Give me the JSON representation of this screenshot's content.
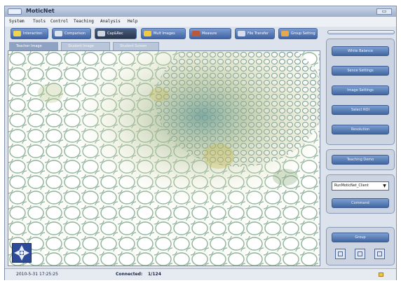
{
  "window": {
    "title": "MoticNet"
  },
  "menu": [
    "System",
    "Tools",
    "Control",
    "Teaching",
    "Analysis",
    "Help"
  ],
  "toolbar": {
    "buttons": [
      {
        "label": "Interaction",
        "icon": "interaction-icon"
      },
      {
        "label": "Comparison",
        "icon": "comparison-icon"
      },
      {
        "label": "Cap&Rec",
        "icon": "camera-icon"
      },
      {
        "label": "Mult Images",
        "icon": "images-icon"
      },
      {
        "label": "Measure",
        "icon": "measure-icon"
      },
      {
        "label": "File Transfer",
        "icon": "file-transfer-icon"
      },
      {
        "label": "Group Setting",
        "icon": "group-icon"
      }
    ],
    "active_index": 2
  },
  "subtabs": [
    "Teacher Image",
    "Student Image",
    "Student Screen"
  ],
  "right_panel": {
    "camera_buttons": [
      "White Balance",
      "Sence Settings",
      "Image Settings",
      "Select ROI",
      "Resolution"
    ],
    "teaching_button": "Teaching Demo",
    "client_select": "RunMoticNet_Client",
    "command_button": "Command",
    "group_button": "Group"
  },
  "status": {
    "datetime": "2010-5-31 17:25:25",
    "connected_label": "Connected:",
    "connected_value": "1/124"
  },
  "colors": {
    "button_blue": "#4a6ea8",
    "panel_bg": "#ccd4e1",
    "window_bg": "#dde3ec"
  }
}
